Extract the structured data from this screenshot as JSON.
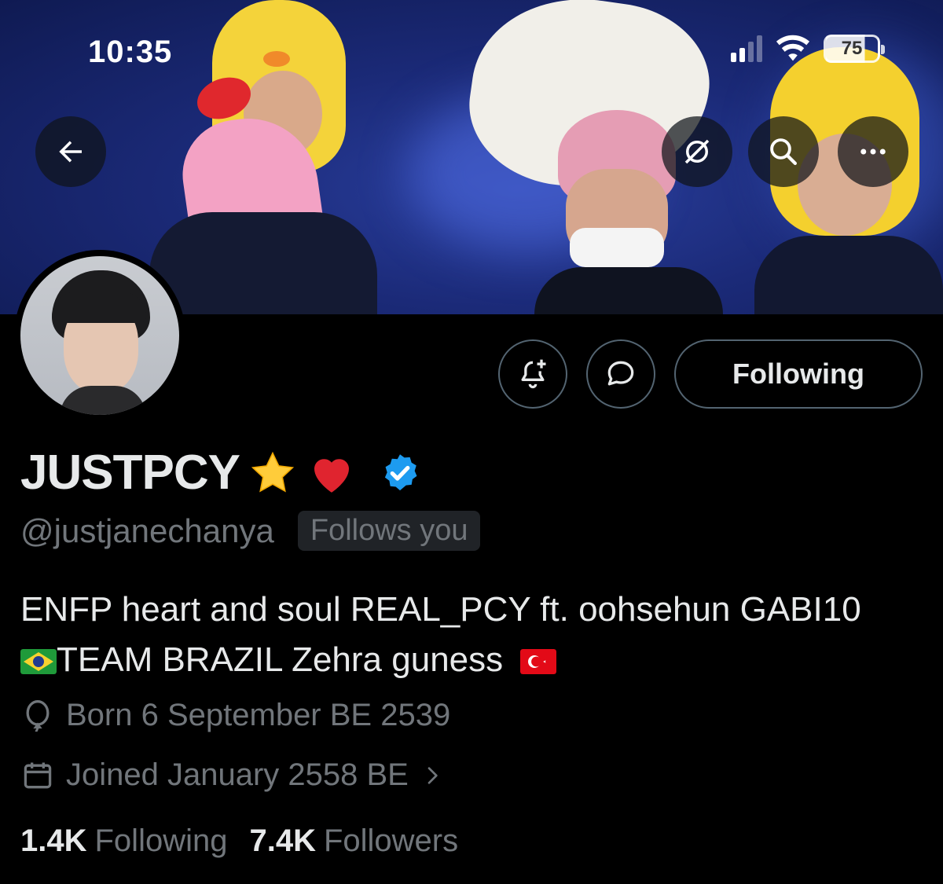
{
  "status_bar": {
    "time": "10:35",
    "battery": "75"
  },
  "header": {
    "back_icon": "arrow-left-icon",
    "translate_icon": "eye-slash-icon",
    "search_icon": "search-icon",
    "more_icon": "more-dots-icon"
  },
  "profile": {
    "display_name": "JUSTPCY",
    "name_emojis": [
      "⭐",
      "❤️"
    ],
    "verified": true,
    "handle": "@justjanechanya",
    "follows_you": "Follows you",
    "bio_line1": "ENFP heart and soul REAL_PCY ft. oohsehun GABI10",
    "bio_line2": "TEAM BRAZIL Zehra guness",
    "born": "Born 6 September BE 2539",
    "joined": "Joined January 2558 BE",
    "following_count": "1.4K",
    "following_label": "Following",
    "followers_count": "7.4K",
    "followers_label": "Followers"
  },
  "actions": {
    "notify_icon": "bell-plus-icon",
    "message_icon": "message-bubble-icon",
    "following_button": "Following"
  },
  "colors": {
    "background": "#000000",
    "text_primary": "#e7e9ea",
    "text_secondary": "#71767b",
    "border": "#536471",
    "verified_blue": "#1d9bf0",
    "banner_blue": "#1b2a78"
  }
}
